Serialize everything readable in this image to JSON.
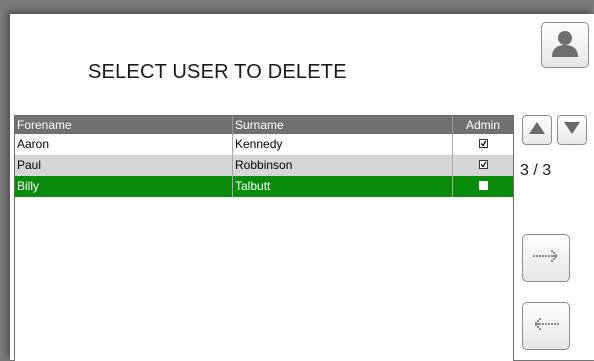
{
  "title": "SELECT USER TO DELETE",
  "table": {
    "columns": [
      "Forename",
      "Surname",
      "Admin"
    ],
    "rows": [
      {
        "forename": "Aaron",
        "surname": "Kennedy",
        "admin": true
      },
      {
        "forename": "Paul",
        "surname": "Robbinson",
        "admin": true
      },
      {
        "forename": "Billy",
        "surname": "Talbutt",
        "admin": false
      }
    ],
    "selected_row": 2
  },
  "pager": {
    "text": "3 / 3"
  },
  "icons": {
    "user": "user-silhouette-icon",
    "up": "triangle-up-icon",
    "down": "triangle-down-icon",
    "next": "dotted-arrow-right-icon",
    "back": "dotted-arrow-left-icon"
  },
  "colors": {
    "selected_row": "#0a8a0a",
    "header": "#707070",
    "alt_row": "#d6d6d6"
  }
}
